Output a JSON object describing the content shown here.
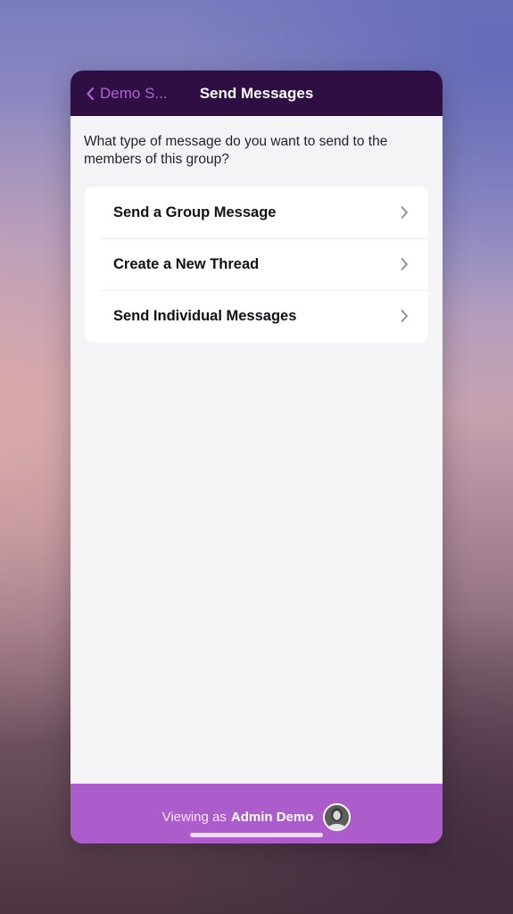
{
  "header": {
    "back_label": "Demo S...",
    "title": "Send Messages"
  },
  "prompt": "What type of message do you want to send to the members of this group?",
  "options": [
    {
      "label": "Send a Group Message"
    },
    {
      "label": "Create a New Thread"
    },
    {
      "label": "Send Individual Messages"
    }
  ],
  "footer": {
    "viewing_prefix": "Viewing as",
    "viewing_name": "Admin Demo"
  },
  "colors": {
    "header_bg": "#2f0f43",
    "accent": "#b062d8",
    "footer_bg": "#ad5ccb",
    "content_bg": "#f4f4f7"
  },
  "icons": {
    "back": "chevron-left-icon",
    "row_arrow": "chevron-right-icon",
    "avatar": "user-avatar"
  }
}
